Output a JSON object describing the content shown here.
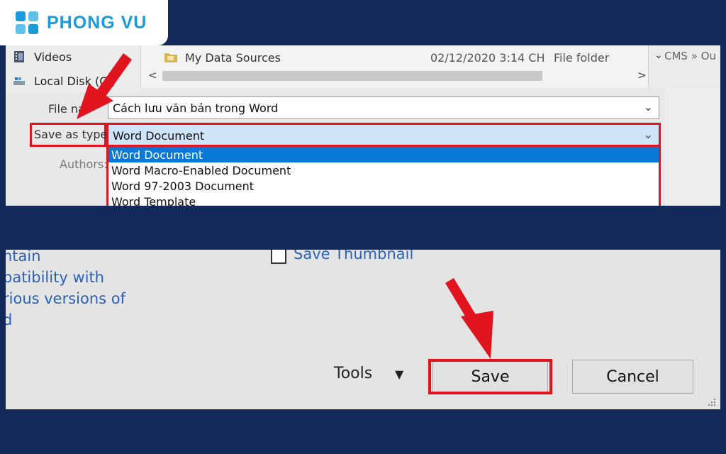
{
  "brand": {
    "name": "PHONG VU",
    "color": "#1a9ad6"
  },
  "nav_pane": {
    "items": [
      {
        "label": "Videos",
        "icon": "video-folder-icon"
      },
      {
        "label": "Local Disk (C:)",
        "icon": "drive-icon"
      }
    ]
  },
  "file_list": {
    "rows": [
      {
        "name": "My Data Sources",
        "date": "02/12/2020 3:14 CH",
        "type": "File folder",
        "icon": "data-folder-icon"
      }
    ]
  },
  "path_bar": {
    "text": "CMS » Ou"
  },
  "form": {
    "file_name_label": "File na",
    "file_name_value": "Cách lưu văn bản trong Word",
    "save_as_type_label": "Save as type:",
    "save_as_type_value": "Word Document",
    "authors_label": "Authors:"
  },
  "type_dropdown": {
    "options": [
      "Word Document",
      "Word Macro-Enabled Document",
      "Word 97-2003 Document",
      "Word Template"
    ],
    "selected_index": 0
  },
  "options_area": {
    "compat_lines": [
      "ntain",
      "patibility with",
      "rious versions of",
      "d"
    ],
    "thumbnail_label": "Save Thumbnail"
  },
  "footer": {
    "tools_label": "Tools",
    "save_label": "Save",
    "cancel_label": "Cancel"
  },
  "colors": {
    "highlight_red": "#e0141e",
    "selection_blue": "#0a78d7",
    "background": "#13295a"
  }
}
